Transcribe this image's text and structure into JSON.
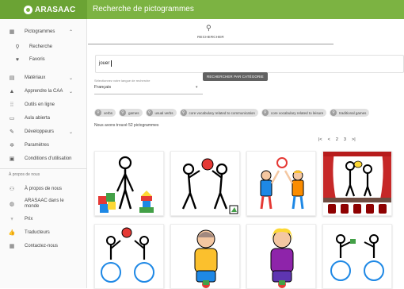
{
  "app": {
    "brand": "ARASAAC",
    "page_title": "Recherche de pictogrammes",
    "brand_color": "#7cb342"
  },
  "sidebar": {
    "items": [
      {
        "label": "Pictogrammes",
        "icon": "image-icon"
      },
      {
        "label": "Recherche",
        "icon": "search-icon"
      },
      {
        "label": "Favoris",
        "icon": "heart-icon"
      },
      {
        "label": "Matériaux",
        "icon": "materials-icon"
      },
      {
        "label": "Apprendre la CAA",
        "icon": "school-icon"
      },
      {
        "label": "Outils en ligne",
        "icon": "grid-icon"
      },
      {
        "label": "Aula abierta",
        "icon": "laptop-icon"
      },
      {
        "label": "Développeurs",
        "icon": "wrench-icon"
      },
      {
        "label": "Paramètres",
        "icon": "gear-icon"
      },
      {
        "label": "Conditions d'utilisation",
        "icon": "document-icon"
      }
    ],
    "section_label": "À propos de nous",
    "about_items": [
      {
        "label": "À propos de nous",
        "icon": "people-icon"
      },
      {
        "label": "ARASAAC dans le monde",
        "icon": "globe-icon"
      },
      {
        "label": "Prix",
        "icon": "trophy-icon"
      },
      {
        "label": "Traducteurs",
        "icon": "thumbs-up-icon"
      },
      {
        "label": "Contactez-nous",
        "icon": "contact-card-icon"
      }
    ]
  },
  "tab": {
    "label": "RECHERCHER"
  },
  "search": {
    "value": "jouer"
  },
  "tooltip": {
    "text": "RECHERCHER PAR CATÉGORIE"
  },
  "language": {
    "label": "Sélectionnez votre langue de recherche",
    "selected": "Français"
  },
  "chips": [
    "verbs",
    "games",
    "usual verbs",
    "core vocabulary related to communication",
    "core vocabulary related to leisure",
    "traditional games"
  ],
  "results": {
    "found_text": "Nous avons trouvé 52 pictogrammes"
  },
  "pagination": [
    "|<",
    "<",
    "2",
    "3",
    ">|"
  ]
}
